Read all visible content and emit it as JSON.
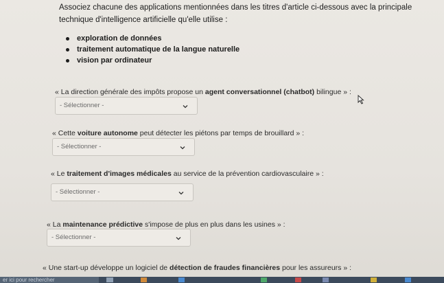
{
  "intro": "Associez chacune des applications mentionnées dans les titres d'article ci-dessous avec la principale technique d'intelligence artificielle qu'elle utilise :",
  "options": [
    "exploration de données",
    "traitement automatique de la langue naturelle",
    "vision par ordinateur"
  ],
  "questions": [
    {
      "before": "« La direction générale des impôts propose un ",
      "bold": "agent conversationnel (chatbot)",
      "after": " bilingue » :",
      "select": "- Sélectionner -"
    },
    {
      "before": "« Cette ",
      "bold": "voiture autonome",
      "after": " peut détecter les piétons par temps de brouillard » :",
      "select": "- Sélectionner -"
    },
    {
      "before": "« Le ",
      "bold": "traitement d'images médicales",
      "after": " au service de la prévention cardiovasculaire » :",
      "select": "- Sélectionner -"
    },
    {
      "before": "« La ",
      "bold": "maintenance prédictive",
      "after": " s'impose de plus en plus dans les usines » :",
      "select": "- Sélectionner -"
    },
    {
      "before": "« Une start-up développe un logiciel de ",
      "bold": "détection de fraudes financières",
      "after": " pour les assureurs » :",
      "select": ""
    }
  ],
  "taskbar": {
    "search_placeholder": "er ici pour rechercher",
    "color": "#3c4a5c"
  },
  "colors": {
    "background": "#e6e3de",
    "select_border": "#c8c5bf"
  }
}
